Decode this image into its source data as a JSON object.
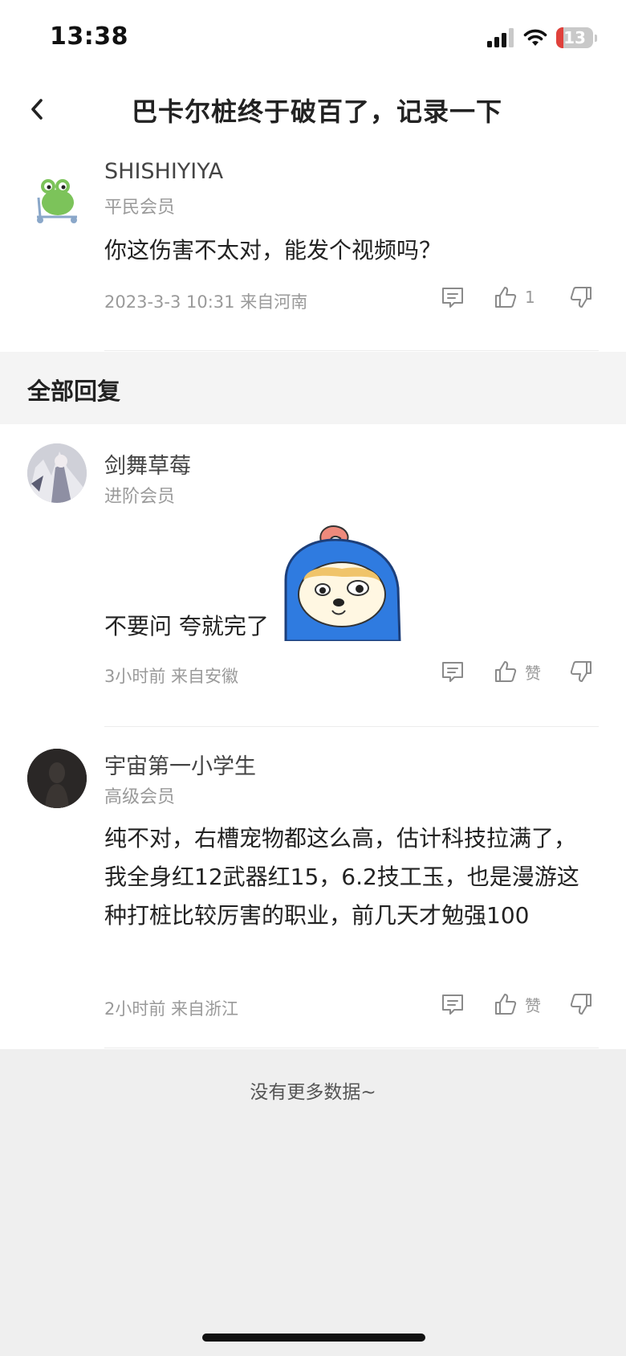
{
  "status": {
    "time": "13:38",
    "battery": "13"
  },
  "header": {
    "title": "巴卡尔桩终于破百了，记录一下"
  },
  "main_comment": {
    "username": "SHISHIYIYA",
    "rank": "平民会员",
    "text": "你这伤害不太对，能发个视频吗？",
    "meta": "2023-3-3 10:31 来自河南",
    "like_count": "1"
  },
  "section": {
    "title": "全部回复"
  },
  "replies": [
    {
      "username": "剑舞草莓",
      "rank": "进阶会员",
      "text": "不要问 夸就完了",
      "meta": "3小时前 来自安徽",
      "like_label": "赞"
    },
    {
      "username": "宇宙第一小学生",
      "rank": "高级会员",
      "text": "纯不对，右槽宠物都这么高，估计科技拉满了，我全身红12武器红15，6.2技工玉，也是漫游这种打桩比较厉害的职业，前几天才勉强100",
      "meta": "2小时前 来自浙江",
      "like_label": "赞"
    }
  ],
  "footer": {
    "no_more": "没有更多数据~"
  },
  "icons": [
    "back-arrow-icon",
    "signal-icon",
    "wifi-icon",
    "battery-icon",
    "comment-icon",
    "thumbs-up-icon",
    "thumbs-down-icon"
  ]
}
